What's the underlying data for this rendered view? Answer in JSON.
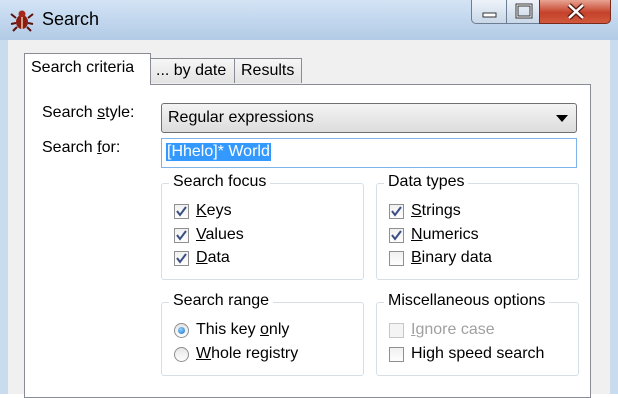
{
  "window": {
    "title": "Search",
    "icon": "app-bug-icon"
  },
  "tabs": [
    {
      "label": "Search criteria",
      "active": true
    },
    {
      "label": "... by date",
      "active": false
    },
    {
      "label": "Results",
      "active": false
    }
  ],
  "search_style": {
    "label_pre": "Search ",
    "label_ul": "s",
    "label_post": "tyle:",
    "value": "Regular expressions"
  },
  "search_for": {
    "label_pre": "Search ",
    "label_ul": "f",
    "label_post": "or:",
    "value": "[Hhelo]* World"
  },
  "search_focus": {
    "title": "Search focus",
    "keys": {
      "ul": "K",
      "rest": "eys",
      "checked": true
    },
    "values": {
      "ul": "V",
      "rest": "alues",
      "checked": true
    },
    "data": {
      "ul": "D",
      "rest": "ata",
      "checked": true
    }
  },
  "data_types": {
    "title": "Data types",
    "strings": {
      "ul": "S",
      "rest": "trings",
      "checked": true
    },
    "numerics": {
      "ul": "N",
      "rest": "umerics",
      "checked": true
    },
    "binary": {
      "ul": "B",
      "rest": "inary data",
      "checked": false
    }
  },
  "search_range": {
    "title": "Search range",
    "this_key": {
      "pre": "This key ",
      "ul": "o",
      "post": "nly",
      "selected": true
    },
    "whole": {
      "ul": "W",
      "rest": "hole registry",
      "selected": false
    }
  },
  "misc": {
    "title": "Miscellaneous options",
    "ignore_case": {
      "ul": "I",
      "rest": "gnore case",
      "checked": false,
      "enabled": false
    },
    "high_speed": {
      "label": "High speed search",
      "checked": false
    }
  }
}
